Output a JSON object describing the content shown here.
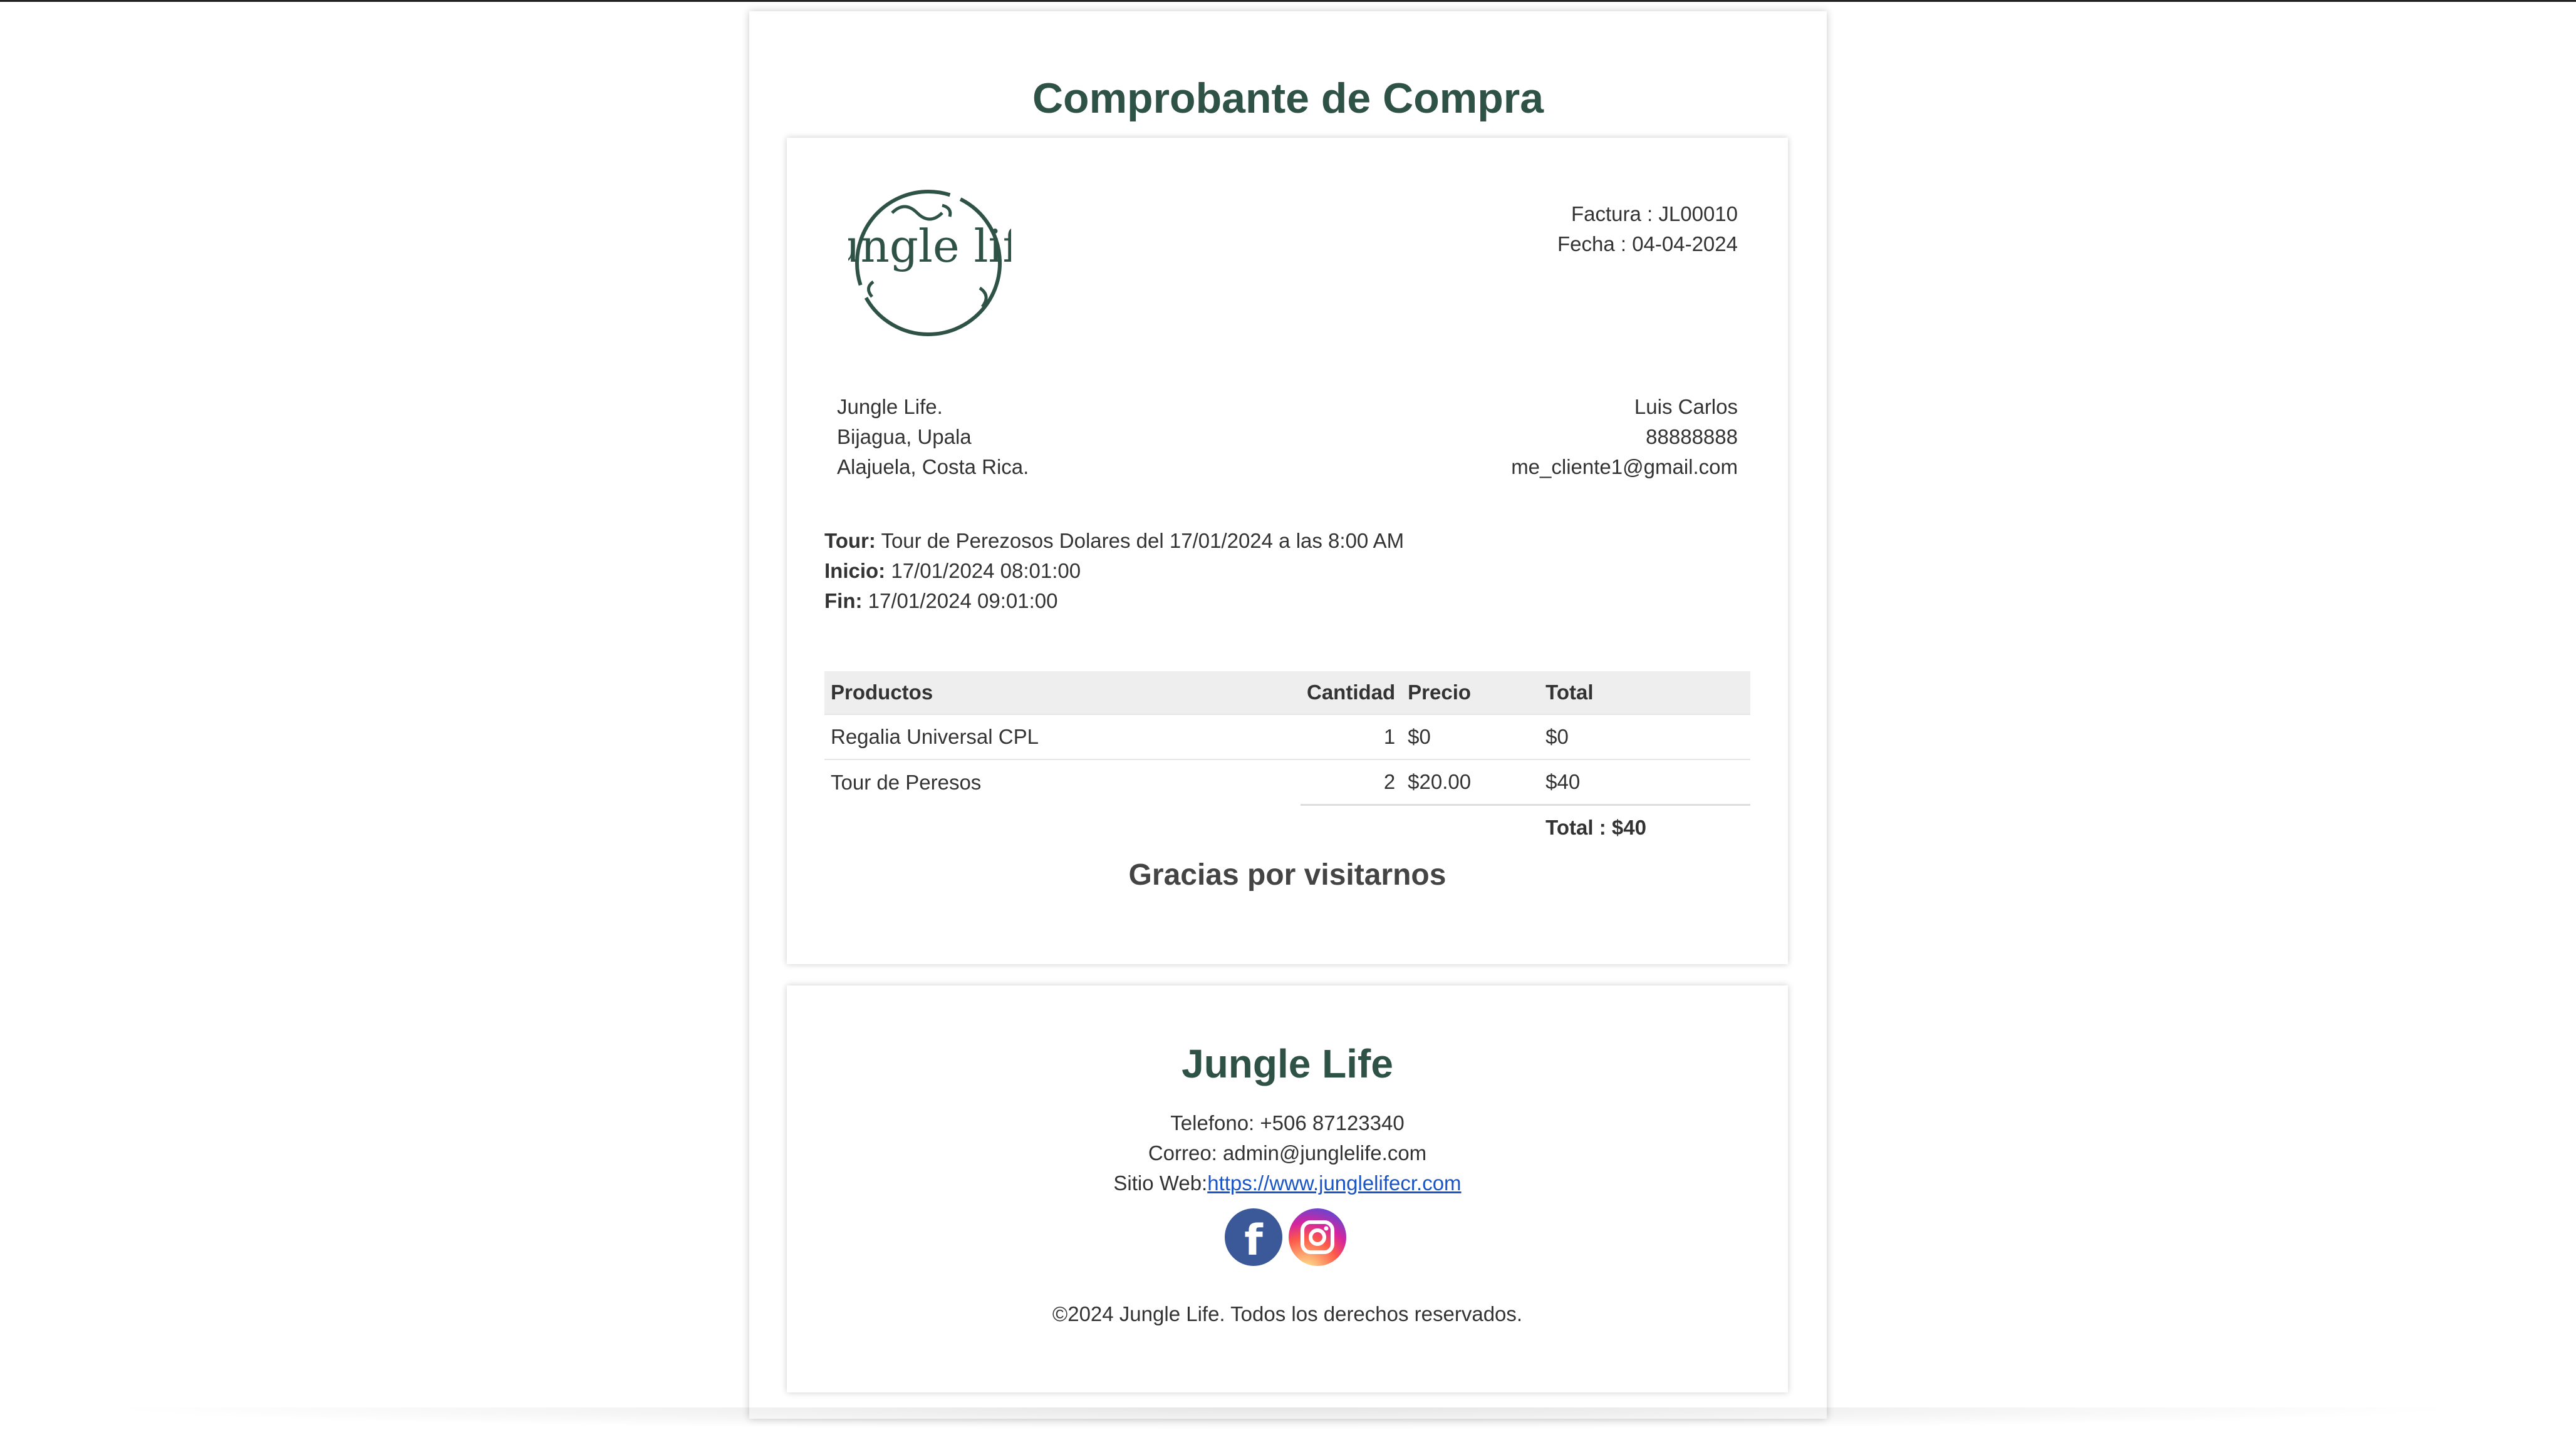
{
  "receipt": {
    "title": "Comprobante de Compra",
    "logo_text": "Jungle life",
    "invoice_label": "Factura : JL00010",
    "date_label": "Fecha : 04-04-2024",
    "company": {
      "name": "Jungle Life.",
      "line1": "Bijagua, Upala",
      "line2": "Alajuela, Costa Rica."
    },
    "client": {
      "name": "Luis Carlos",
      "phone": "88888888",
      "email": "me_cliente1@gmail.com"
    },
    "tour": {
      "tour_label": "Tour:",
      "tour_value": "Tour de Perezosos Dolares del 17/01/2024 a las 8:00 AM",
      "start_label": "Inicio:",
      "start_value": "17/01/2024 08:01:00",
      "end_label": "Fin:",
      "end_value": "17/01/2024 09:01:00"
    },
    "table": {
      "headers": [
        "Productos",
        "Cantidad",
        "Precio",
        "Total"
      ],
      "rows": [
        {
          "product": "Regalia Universal CPL",
          "qty": "1",
          "price": "$0",
          "total": "$0"
        },
        {
          "product": "Tour de Peresos",
          "qty": "2",
          "price": "$20.00",
          "total": "$40"
        }
      ],
      "total_label": "Total : $40"
    },
    "thanks": "Gracias por visitarnos"
  },
  "footer": {
    "name": "Jungle Life",
    "phone": "Telefono: +506 87123340",
    "email": "Correo: admin@junglelife.com",
    "web_label": "Sitio Web:",
    "web_link": "https://www.junglelifecr.com",
    "facebook_letter": "f",
    "copyright": "©2024 Jungle Life. Todos los derechos reservados."
  },
  "colors": {
    "brand_green": "#2f5247",
    "link_blue": "#1a55c6",
    "facebook_blue": "#3b5998"
  }
}
